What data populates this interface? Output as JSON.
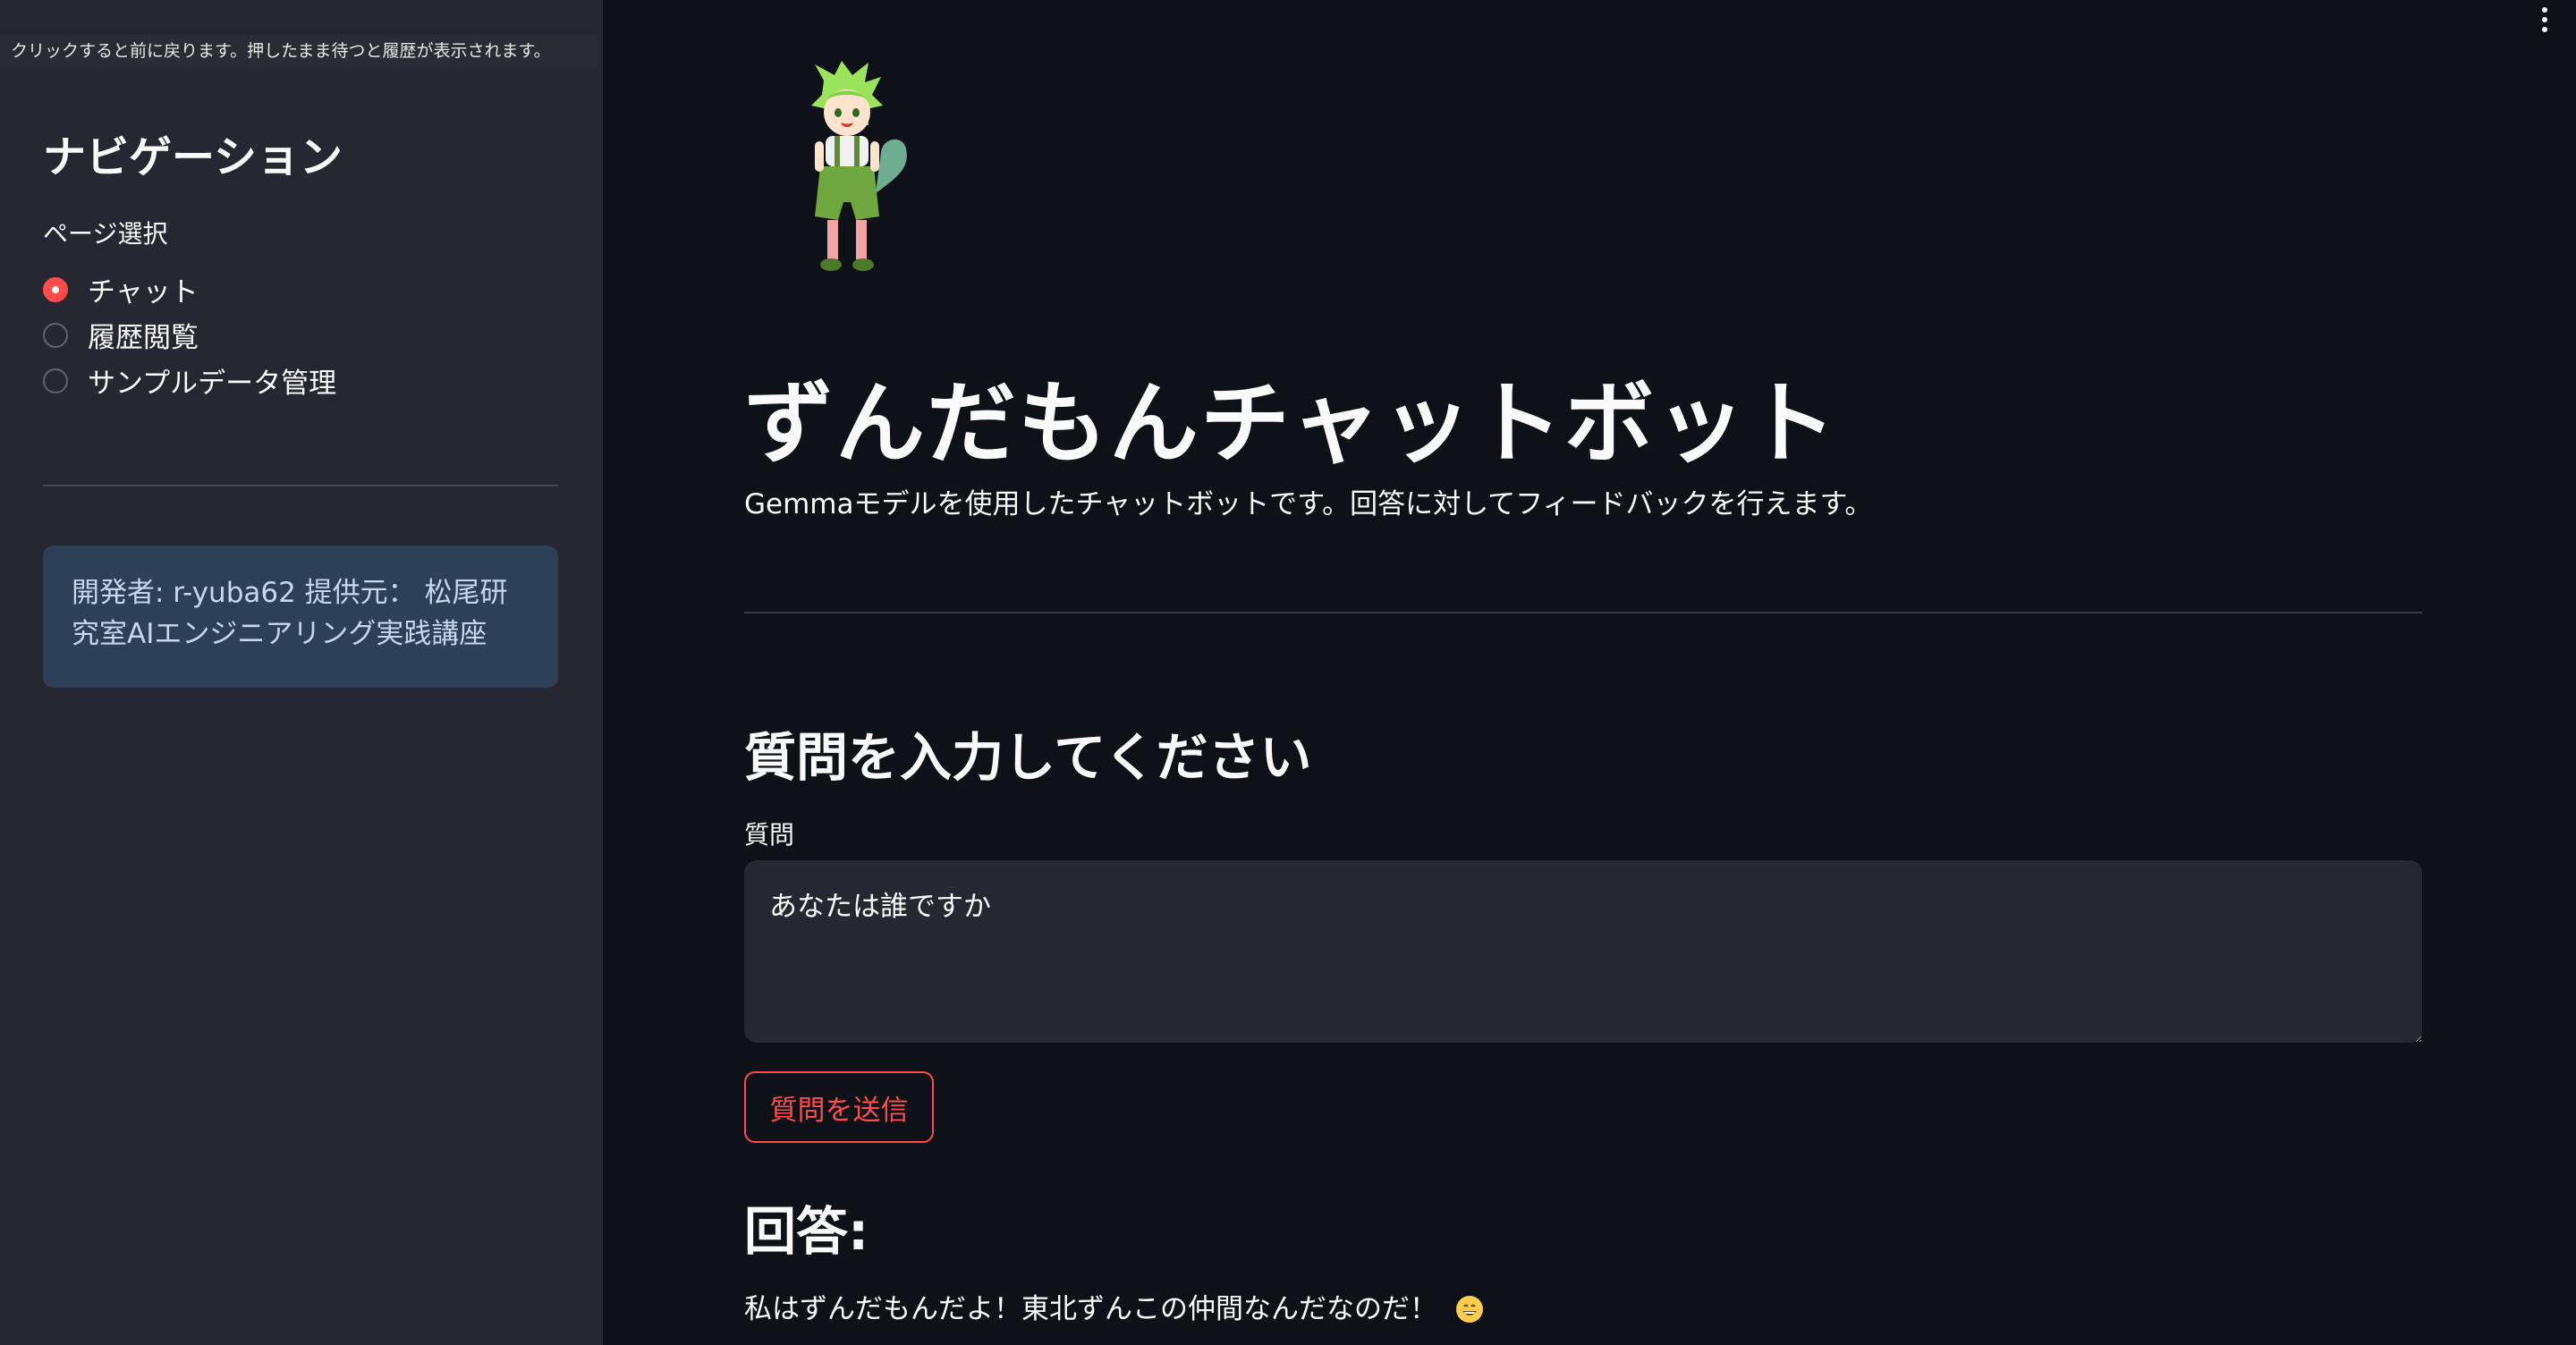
{
  "tooltip": "クリックすると前に戻ります。押したまま待つと履歴が表示されます。",
  "sidebar": {
    "title": "ナビゲーション",
    "radio_label": "ページ選択",
    "options": [
      {
        "label": "チャット",
        "selected": true
      },
      {
        "label": "履歴閲覧",
        "selected": false
      },
      {
        "label": "サンプルデータ管理",
        "selected": false
      }
    ],
    "info": "開発者: r-yuba62 提供元： 松尾研究室AIエンジニアリング実践講座"
  },
  "main": {
    "avatar_icon": "character-avatar-icon",
    "title": "ずんだもんチャットボット",
    "subtitle": "Gemmaモデルを使用したチャットボットです。回答に対してフィードバックを行えます。",
    "section_title": "質問を入力してください",
    "question_label": "質問",
    "question_value": "あなたは誰ですか",
    "submit_label": "質問を送信",
    "answer_title": "回答:",
    "answer_text": "私はずんだもんだよ！東北ずんこの仲間なんだなのだ！",
    "answer_emoji_icon": "grinning-face-icon"
  },
  "colors": {
    "accent": "#ff4b4b",
    "background": "#0e1117",
    "sidebar": "#262730",
    "info_box": "#2e3f58"
  }
}
